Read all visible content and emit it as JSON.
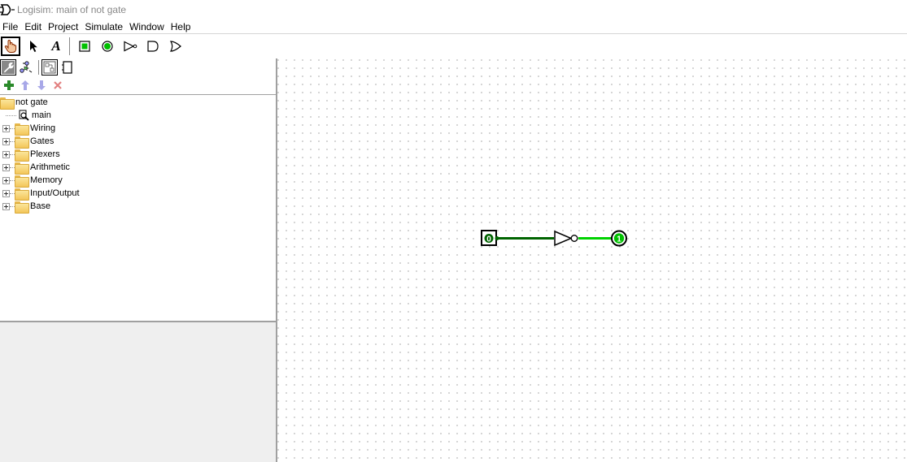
{
  "window": {
    "title": "Logisim: main of not gate"
  },
  "menu": [
    "File",
    "Edit",
    "Project",
    "Simulate",
    "Window",
    "Help"
  ],
  "toolbar": {
    "tools": [
      {
        "name": "poke-tool",
        "icon": "hand-icon",
        "selected": true
      },
      {
        "name": "edit-tool",
        "icon": "arrow-icon"
      },
      {
        "name": "text-tool",
        "icon": "text-icon",
        "glyph": "A"
      },
      {
        "name": "input-pin-tool",
        "icon": "input-pin-icon"
      },
      {
        "name": "output-pin-tool",
        "icon": "output-pin-icon"
      },
      {
        "name": "not-gate-tool",
        "icon": "not-gate-icon"
      },
      {
        "name": "and-gate-tool",
        "icon": "and-gate-icon"
      },
      {
        "name": "or-gate-tool",
        "icon": "or-gate-icon"
      }
    ]
  },
  "explorer": {
    "project": "not gate",
    "circuit": "main",
    "libraries": [
      "Wiring",
      "Gates",
      "Plexers",
      "Arithmetic",
      "Memory",
      "Input/Output",
      "Base"
    ]
  },
  "circuit": {
    "input_value": "0",
    "output_value": "1"
  },
  "colors": {
    "wire_low": "#006400",
    "wire_high": "#00d200",
    "output_fill": "#00c000",
    "add_green": "#2a8a2a",
    "arrow_purple": "#a8a8e8",
    "delete_red": "#e28080"
  }
}
